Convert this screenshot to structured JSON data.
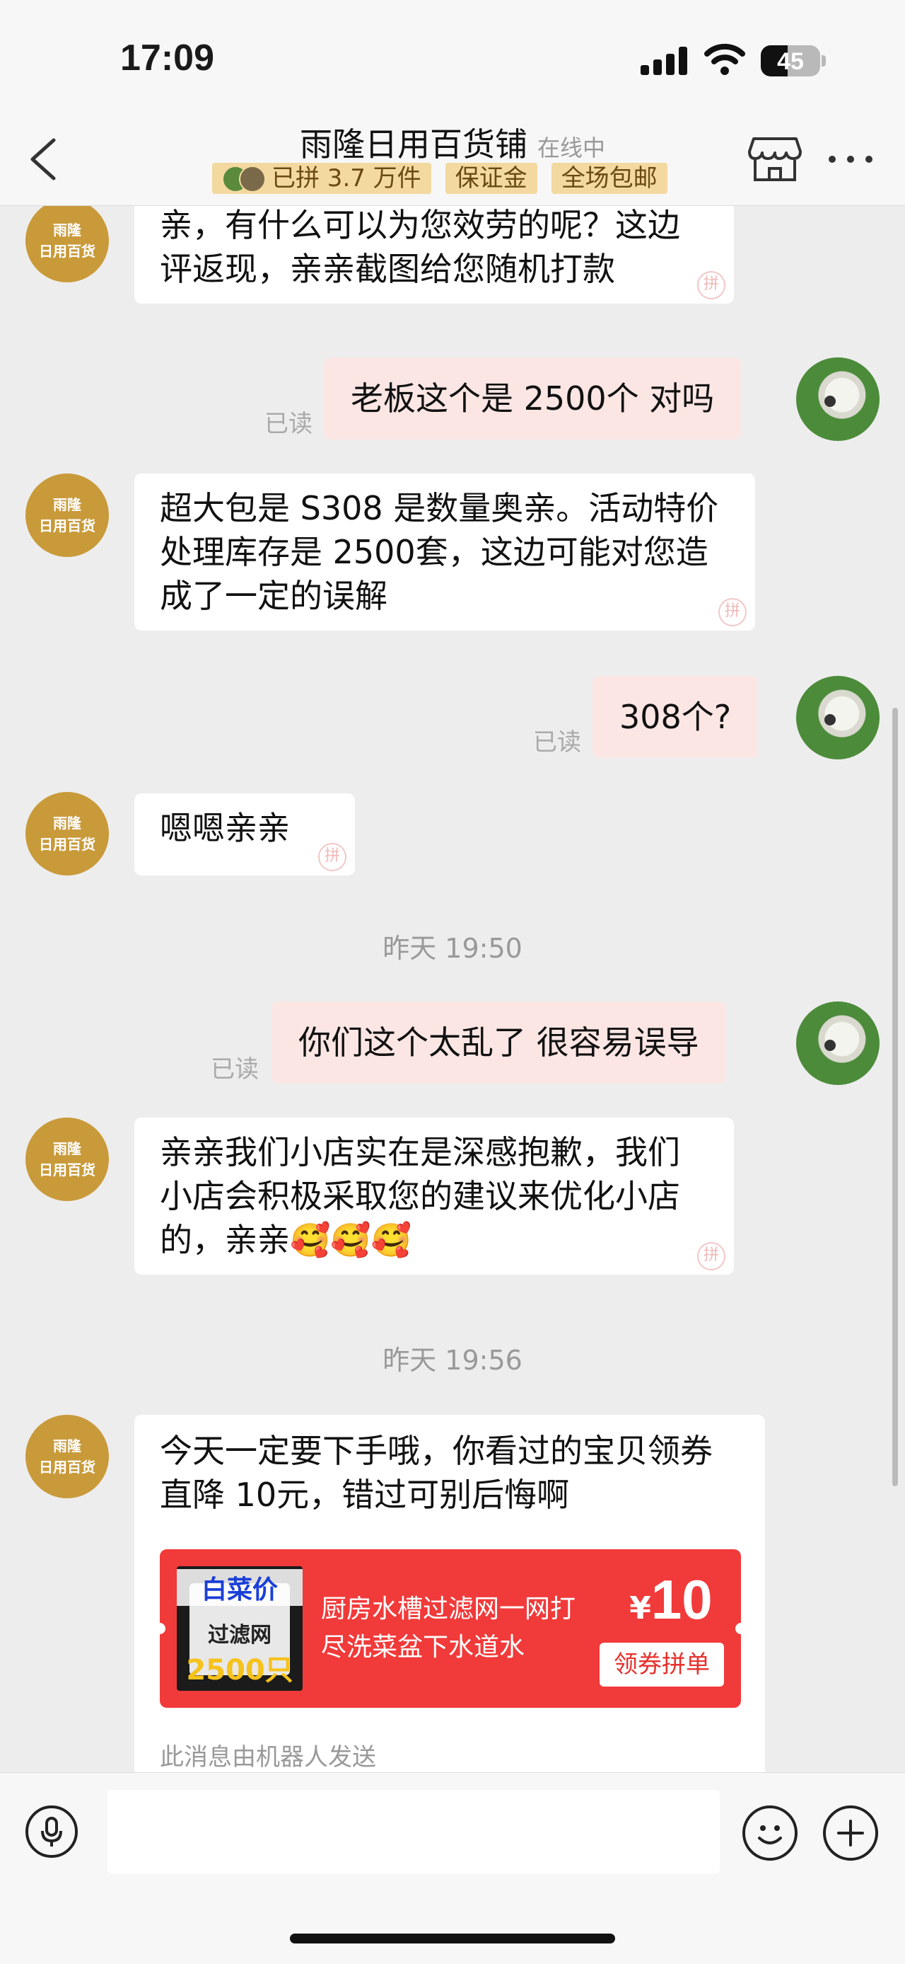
{
  "status_bar": {
    "time": "17:09",
    "battery": "45",
    "battery_level": 0.45
  },
  "header": {
    "shop_name": "雨隆日用百货铺",
    "online_status": "在线中",
    "badges": [
      "已拼 3.7 万件",
      "保证金",
      "全场包邮"
    ]
  },
  "shop_avatar": {
    "line1": "雨隆",
    "line2": "日用百货"
  },
  "messages": [
    {
      "side": "left",
      "text": "亲，有什么可以为您效劳的呢？这边评返现，亲亲截图给您随机打款"
    },
    {
      "side": "right",
      "text": "老板这个是 2500个 对吗",
      "status": "已读"
    },
    {
      "side": "left",
      "text": "超大包是 S308 是数量奥亲。活动特价处理库存是 2500套，这边可能对您造成了一定的误解"
    },
    {
      "side": "right",
      "text": "308个?",
      "status": "已读"
    },
    {
      "side": "left",
      "text": "嗯嗯亲亲"
    },
    {
      "type": "time",
      "text": "昨天 19:50"
    },
    {
      "side": "right",
      "text": "你们这个太乱了 很容易误导",
      "status": "已读"
    },
    {
      "side": "left",
      "text": "亲亲我们小店实在是深感抱歉，我们小店会积极采取您的建议来优化小店的，亲亲🥰🥰🥰"
    },
    {
      "type": "time",
      "text": "昨天 19:56"
    }
  ],
  "bot_message": {
    "text": "今天一定要下手哦，你看过的宝贝领券直降 10元，错过可别后悔啊",
    "coupon": {
      "img_text1": "白菜价",
      "img_text2": "过滤网",
      "img_text3": "2500只",
      "title": "厨房水槽过滤网一网打尽洗菜盆下水道水",
      "currency": "¥",
      "amount": "10",
      "button": "领券拼单"
    },
    "note": "此消息由机器人发送"
  },
  "input": {
    "placeholder": ""
  },
  "colors": {
    "badge_bg": "#f3d99f",
    "shop_avatar": "#c99a3a",
    "right_bubble": "#fbe6e4",
    "coupon": "#f13a3a"
  },
  "icons": [
    "back-icon",
    "store-icon",
    "more-icon",
    "microphone-icon",
    "emoji-icon",
    "plus-icon"
  ]
}
